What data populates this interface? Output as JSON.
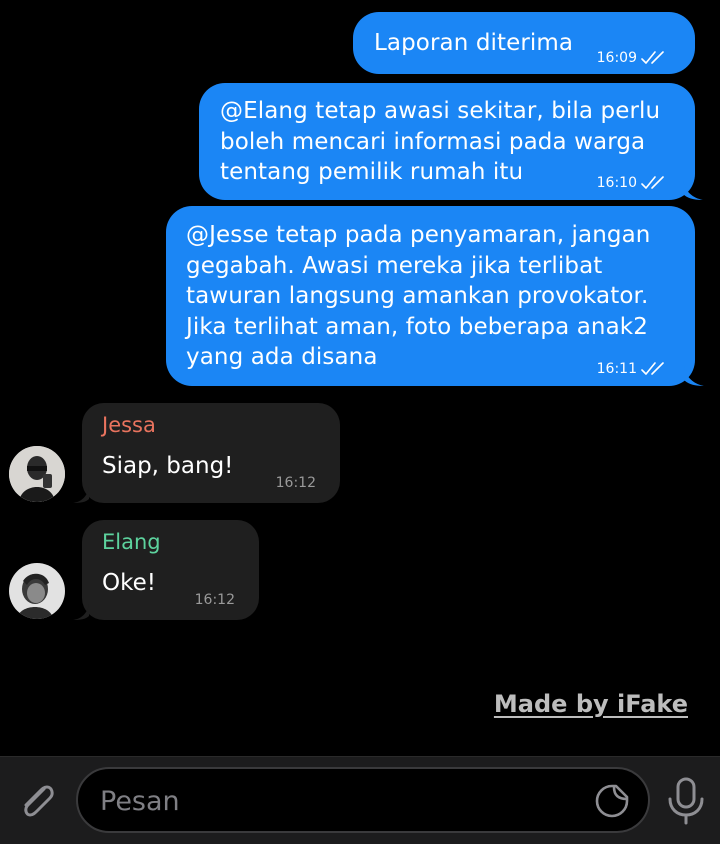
{
  "messages_out": [
    {
      "text": "Laporan diterima",
      "time": "16:09"
    },
    {
      "text": "@Elang tetap awasi sekitar, bila perlu\nboleh mencari informasi pada warga\ntentang pemilik rumah itu",
      "time": "16:10"
    },
    {
      "text": "@Jesse tetap pada penyamaran, jangan\ngegabah. Awasi mereka jika terlibat\ntawuran langsung amankan provokator.\nJika terlihat aman, foto beberapa anak2\nyang ada disana",
      "time": "16:11"
    }
  ],
  "messages_in": [
    {
      "sender": "Jessa",
      "sender_color": "#e9735e",
      "text": "Siap, bang!",
      "time": "16:12"
    },
    {
      "sender": "Elang",
      "sender_color": "#5dd39e",
      "text": "Oke!",
      "time": "16:12"
    }
  ],
  "watermark": "Made by iFake",
  "composer": {
    "placeholder": "Pesan",
    "attach_icon": "paperclip-icon",
    "sticker_icon": "sticker-icon",
    "mic_icon": "microphone-icon"
  },
  "colors": {
    "outgoing_bubble": "#1b86f5",
    "incoming_bubble": "#1f1f1f",
    "background": "#000000"
  }
}
